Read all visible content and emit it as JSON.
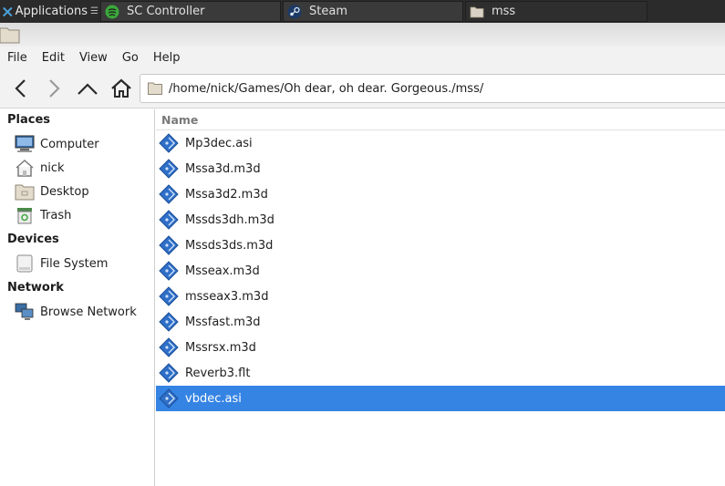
{
  "taskbar": {
    "applications_label": "Applications",
    "tasks": [
      {
        "label": "SC Controller"
      },
      {
        "label": "Steam"
      },
      {
        "label": "mss"
      }
    ]
  },
  "menubar": {
    "items": [
      {
        "label": "File"
      },
      {
        "label": "Edit"
      },
      {
        "label": "View"
      },
      {
        "label": "Go"
      },
      {
        "label": "Help"
      }
    ]
  },
  "location": {
    "path": "/home/nick/Games/Oh dear, oh dear. Gorgeous./mss/"
  },
  "sidebar": {
    "sections": [
      {
        "title": "Places",
        "items": [
          {
            "label": "Computer",
            "icon": "computer-icon"
          },
          {
            "label": "nick",
            "icon": "home-icon"
          },
          {
            "label": "Desktop",
            "icon": "desktop-folder-icon"
          },
          {
            "label": "Trash",
            "icon": "trash-icon"
          }
        ]
      },
      {
        "title": "Devices",
        "items": [
          {
            "label": "File System",
            "icon": "drive-icon"
          }
        ]
      },
      {
        "title": "Network",
        "items": [
          {
            "label": "Browse Network",
            "icon": "network-icon"
          }
        ]
      }
    ]
  },
  "filelist": {
    "column_name": "Name",
    "files": [
      {
        "name": "Mp3dec.asi"
      },
      {
        "name": "Mssa3d.m3d"
      },
      {
        "name": "Mssa3d2.m3d"
      },
      {
        "name": "Mssds3dh.m3d"
      },
      {
        "name": "Mssds3ds.m3d"
      },
      {
        "name": "Msseax.m3d"
      },
      {
        "name": "msseax3.m3d"
      },
      {
        "name": "Mssfast.m3d"
      },
      {
        "name": "Mssrsx.m3d"
      },
      {
        "name": "Reverb3.flt"
      },
      {
        "name": "vbdec.asi",
        "selected": true
      }
    ]
  },
  "colors": {
    "selection": "#3584e4",
    "panel": "#2b2b2b"
  }
}
